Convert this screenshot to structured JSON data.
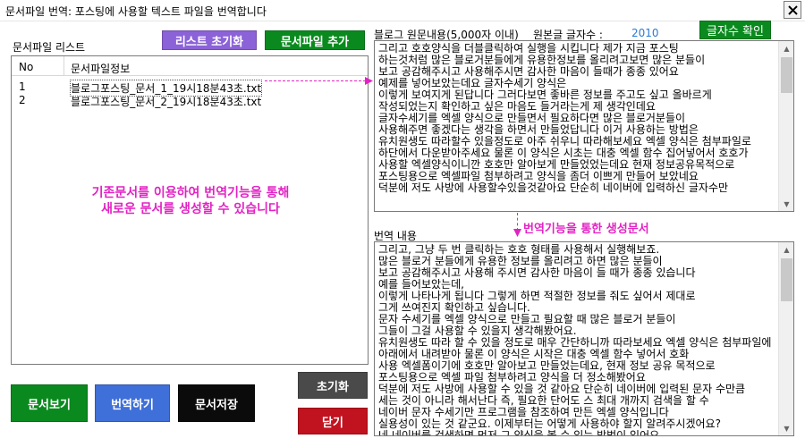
{
  "window": {
    "title": "문서파일 번역: 포스팅에 사용할 텍스트 파일을 번역합니다"
  },
  "labels": {
    "file_list": "문서파일 리스트",
    "source_content": "블로그 원문내용(5,000자 이내)",
    "char_count_label": "원본글 글자수 :",
    "char_count_value": "2010",
    "translation_content": "번역 내용"
  },
  "buttons": {
    "reset_list": "리스트 초기화",
    "add_file": "문서파일 추가",
    "check_count": "글자수 확인",
    "view_doc": "문서보기",
    "translate": "번역하기",
    "save_doc": "문서저장",
    "reset": "초기화",
    "close": "닫기"
  },
  "file_table": {
    "columns": [
      "No",
      "문서파일정보"
    ],
    "rows": [
      {
        "no": "1",
        "file": "블로그포스팅_문서_1_19시18분43초.txt"
      },
      {
        "no": "2",
        "file": "블로그포스팅_문서_2_19시18분43초.txt"
      }
    ]
  },
  "annotations": {
    "left_line1": "기존문서를 이용하여 번역기능을 통해",
    "left_line2": "새로운 문서를 생성할 수 있습니다",
    "right": "번역기능을 통한  생성문서"
  },
  "source_text": "그리고 호호양식을 더블클릭하여 실행을 시킵니다 제가 지금 포스팅\n하는것처럼 많은 블로거분들에게 유용한정보를 올리려고보면 많은 분들이\n보고 공감해주시고 사용해주시면 감사한 마음이 들때가 종종 있어요\n예제를 넣어보았는데요 글자수세기 양식은\n이렇게 보여지게 된답니다 그러다보면 좋바른 정보를 주고도 싶고 올바르게\n작성되었는지 확인하고 싶은 마음도 들거라는게 제 생각인데요\n글자수세기를 엑셀 양식으로 만들면서 필요하다면 많은 블로거분들이\n사용해주면 좋겠다는 생각을 하면서 만들었답니다 이거 사용하는 방법은\n유치원생도 따라할수 있을정도로 아주 쉬우니 따라해보세요 엑셀 양식은 첨부파일로\n하단에서 다운받아주세요 물론 이 양식은 시초는 대충 엑셀 함수 집어넣어서 호호가\n사용할 엑셀양식이니깐 호호만 알아보게 만들었었는데요 현재 정보공유목적으로\n포스팅용으로 엑셀파일 첨부하려고 양식을 좀더 이쁘게 만들어 보았네요\n덕분에 저도 사방에 사용할수있을것같아요 단순히 네이버에 입력하신 글자수만",
  "translated_text": "그리고, 그냥 두 번 클릭하는 호호 형태를 사용해서 실행해보죠.\n많은 블로거 분들에게 유용한 정보를 올리려고 하면 많은 분들이\n보고 공감해주시고 사용해 주시면 감사한 마음이 들 때가 종종 있습니다\n예를 들어보았는데,\n이렇게 나타나게 됩니다 그렇게 하면 적절한 정보를 줘도 싶어서 제대로\n그게 쓰여진지 확인하고 싶습니다.\n문자 수세기를 엑셀 양식으로 만들고 필요할 때 많은 블로거 분들이\n그들이 그걸 사용할 수 있을지 생각해봤어요.\n유치원생도 따라 할 수 있을 정도로 매우 간단하니까 따라보세요 엑셀 양식은 첨부파일에\n아래에서 내려받아 물론 이 양식은 시작은 대충 엑셀 함수 넣어서 호화\n사용 엑셀폼이기에 호호만 알아보고 만들었는데요, 현재 정보 공유 목적으로\n포스팅용으로 엑셀 파일 첨부하려고 양식을 더 정소해봤어요\n덕분에 저도 사방에 사용할 수 있을 것 같아요 단순히 네이버에 입력된 문자 수만큼\n세는 것이 아니라 해서난다 즉, 필요한 단어도 스 최대 개까지 검색을 할 수\n네이버 문자 수세기만 프로그램을 참조하여 만든 엑셀 양식입니다\n실용성이 있는 것 같군요. 이제부터는 어떻게 사용하야 할지 알려주시겠어요?\n네 네이버를 검색하면 먼저 그 양식을 볼 수 있는 방법이 있어요",
  "colors": {
    "accent_annotation": "#e223c4",
    "count_value": "#2a7ad6"
  }
}
